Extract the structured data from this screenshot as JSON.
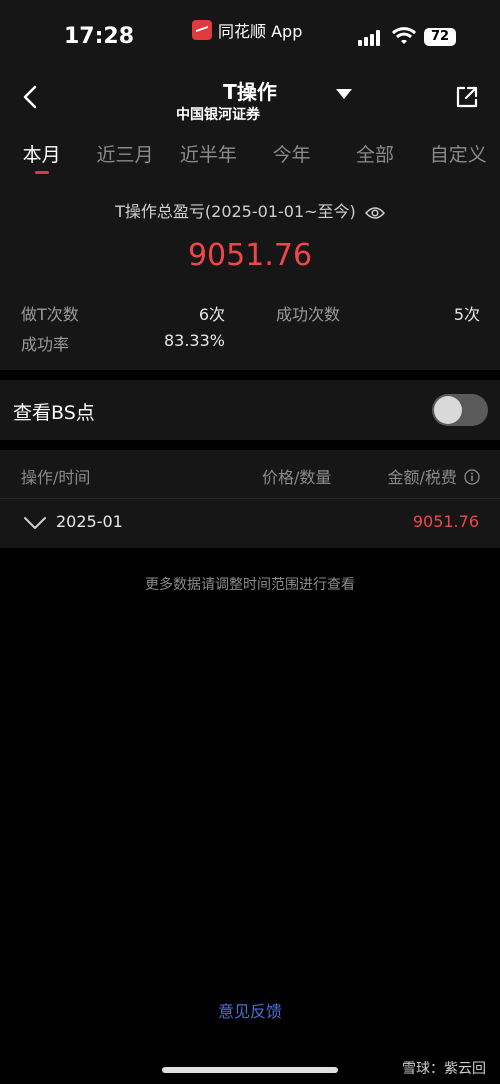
{
  "status_bar": {
    "time": "17:28",
    "app_name": "同花顺 App",
    "battery": "72"
  },
  "nav": {
    "title": "T操作",
    "subtitle": "中国银河证券"
  },
  "tabs": [
    {
      "label": "本月",
      "active": true
    },
    {
      "label": "近三月",
      "active": false
    },
    {
      "label": "近半年",
      "active": false
    },
    {
      "label": "今年",
      "active": false
    },
    {
      "label": "全部",
      "active": false
    },
    {
      "label": "自定义",
      "active": false
    }
  ],
  "summary": {
    "label": "T操作总盈亏(2025-01-01~至今)",
    "value": "9051.76",
    "stats": {
      "t_count_label": "做T次数",
      "t_count_value": "6次",
      "success_count_label": "成功次数",
      "success_count_value": "5次",
      "success_rate_label": "成功率",
      "success_rate_value": "83.33%"
    }
  },
  "bs_toggle": {
    "label": "查看BS点",
    "on": false
  },
  "table": {
    "headers": {
      "op_time": "操作/时间",
      "price_qty": "价格/数量",
      "amount_fee": "金额/税费"
    },
    "rows": [
      {
        "date": "2025-01",
        "amount": "9051.76"
      }
    ]
  },
  "hint": "更多数据请调整时间范围进行查看",
  "feedback": "意见反馈",
  "watermark": "雪球：紫云回",
  "colors": {
    "profit": "#f0464b",
    "accent": "#e0383e",
    "link": "#4a6fd6"
  }
}
